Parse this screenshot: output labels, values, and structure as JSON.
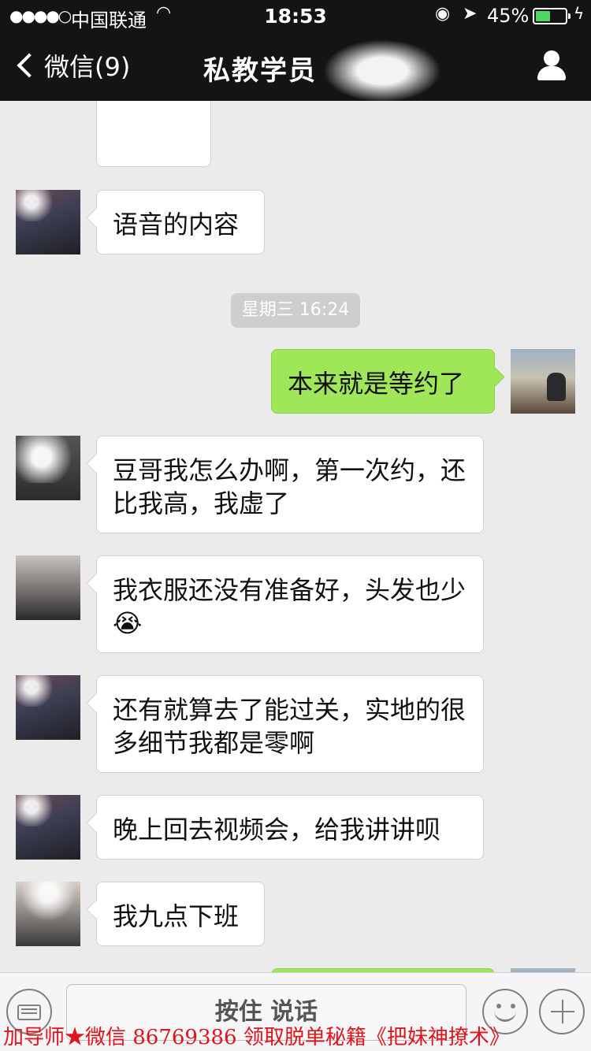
{
  "status_bar": {
    "signal": "●●●●○",
    "carrier": "中国联通",
    "time": "18:53",
    "battery_percent_text": "45%",
    "battery_level": 0.45,
    "battery_color": "#4cd964"
  },
  "nav": {
    "back_label": "微信(9)",
    "title": "私教学员"
  },
  "chat": {
    "timestamp": "星期三 16:24",
    "messages": [
      {
        "side": "left",
        "text": "语音的内容"
      },
      {
        "side": "right",
        "text": "本来就是等约了"
      },
      {
        "side": "left",
        "text": "豆哥我怎么办啊，第一次约，还比我高，我虚了"
      },
      {
        "side": "left",
        "text": "我衣服还没有准备好，头发也少😭"
      },
      {
        "side": "left",
        "text": "还有就算去了能过关，实地的很多细节我都是零啊"
      },
      {
        "side": "left",
        "text": "晚上回去视频会，给我讲讲呗"
      },
      {
        "side": "left",
        "text": "我九点下班"
      }
    ]
  },
  "input_bar": {
    "hold_to_talk": "按住 说话"
  },
  "promo_text": "加导师★微信 86769386 领取脱单秘籍《把妹神撩术》",
  "colors": {
    "header_bg": "#141414",
    "chat_bg": "#ebebeb",
    "sent_bubble": "#9fe658",
    "received_bubble": "#ffffff",
    "promo": "#e0141c"
  }
}
